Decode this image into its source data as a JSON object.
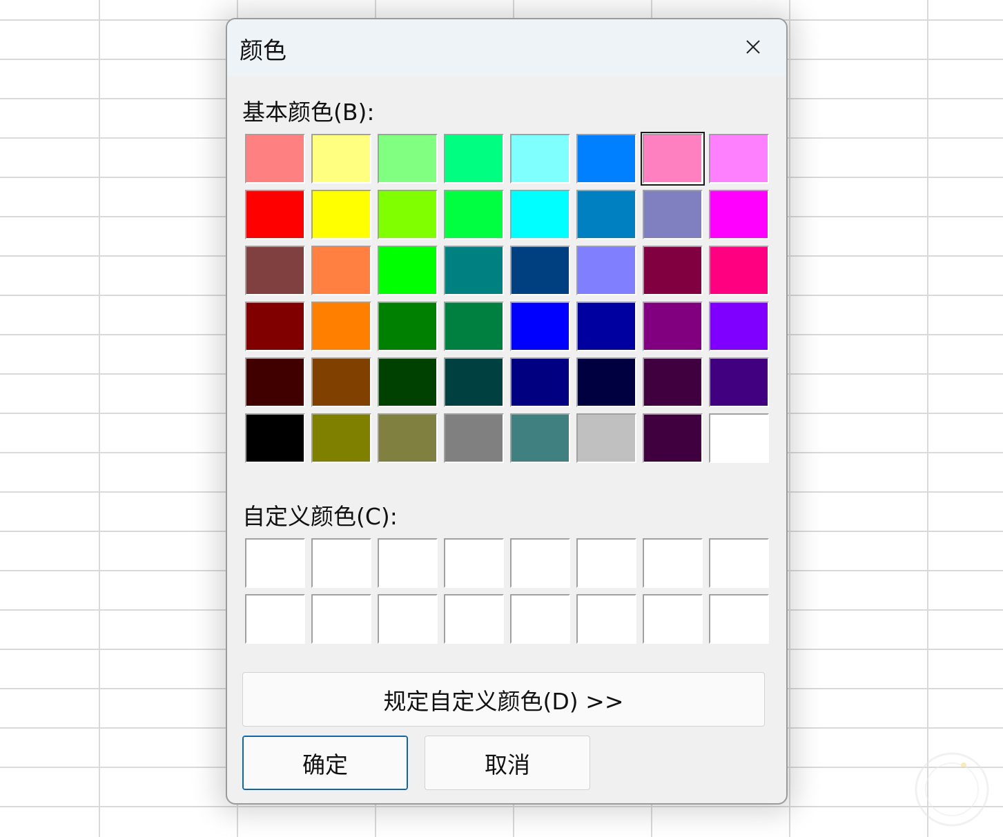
{
  "dialog": {
    "title": "颜色",
    "close_icon": "close-icon"
  },
  "basic_colors": {
    "label": "基本颜色(B):",
    "selected_index": 6,
    "swatches": [
      "#ff8080",
      "#ffff80",
      "#80ff80",
      "#00ff80",
      "#80ffff",
      "#0080ff",
      "#ff80c0",
      "#ff80ff",
      "#ff0000",
      "#ffff00",
      "#80ff00",
      "#00ff40",
      "#00ffff",
      "#0080c0",
      "#8080c0",
      "#ff00ff",
      "#804040",
      "#ff8040",
      "#00ff00",
      "#008080",
      "#004080",
      "#8080ff",
      "#800040",
      "#ff0080",
      "#800000",
      "#ff8000",
      "#008000",
      "#008040",
      "#0000ff",
      "#0000a0",
      "#800080",
      "#8000ff",
      "#400000",
      "#804000",
      "#004000",
      "#004040",
      "#000080",
      "#000040",
      "#400040",
      "#400080",
      "#000000",
      "#808000",
      "#808040",
      "#808080",
      "#408080",
      "#c0c0c0",
      "#400040",
      "#ffffff"
    ]
  },
  "custom_colors": {
    "label": "自定义颜色(C):",
    "swatches": [
      "#ffffff",
      "#ffffff",
      "#ffffff",
      "#ffffff",
      "#ffffff",
      "#ffffff",
      "#ffffff",
      "#ffffff",
      "#ffffff",
      "#ffffff",
      "#ffffff",
      "#ffffff",
      "#ffffff",
      "#ffffff",
      "#ffffff",
      "#ffffff"
    ]
  },
  "buttons": {
    "define_custom": "规定自定义颜色(D) >>",
    "ok": "确定",
    "cancel": "取消"
  },
  "colors": {
    "dialog_bg": "#f0f0f0",
    "titlebar_bg": "#edf3f7",
    "primary_border": "#0e66a8"
  }
}
